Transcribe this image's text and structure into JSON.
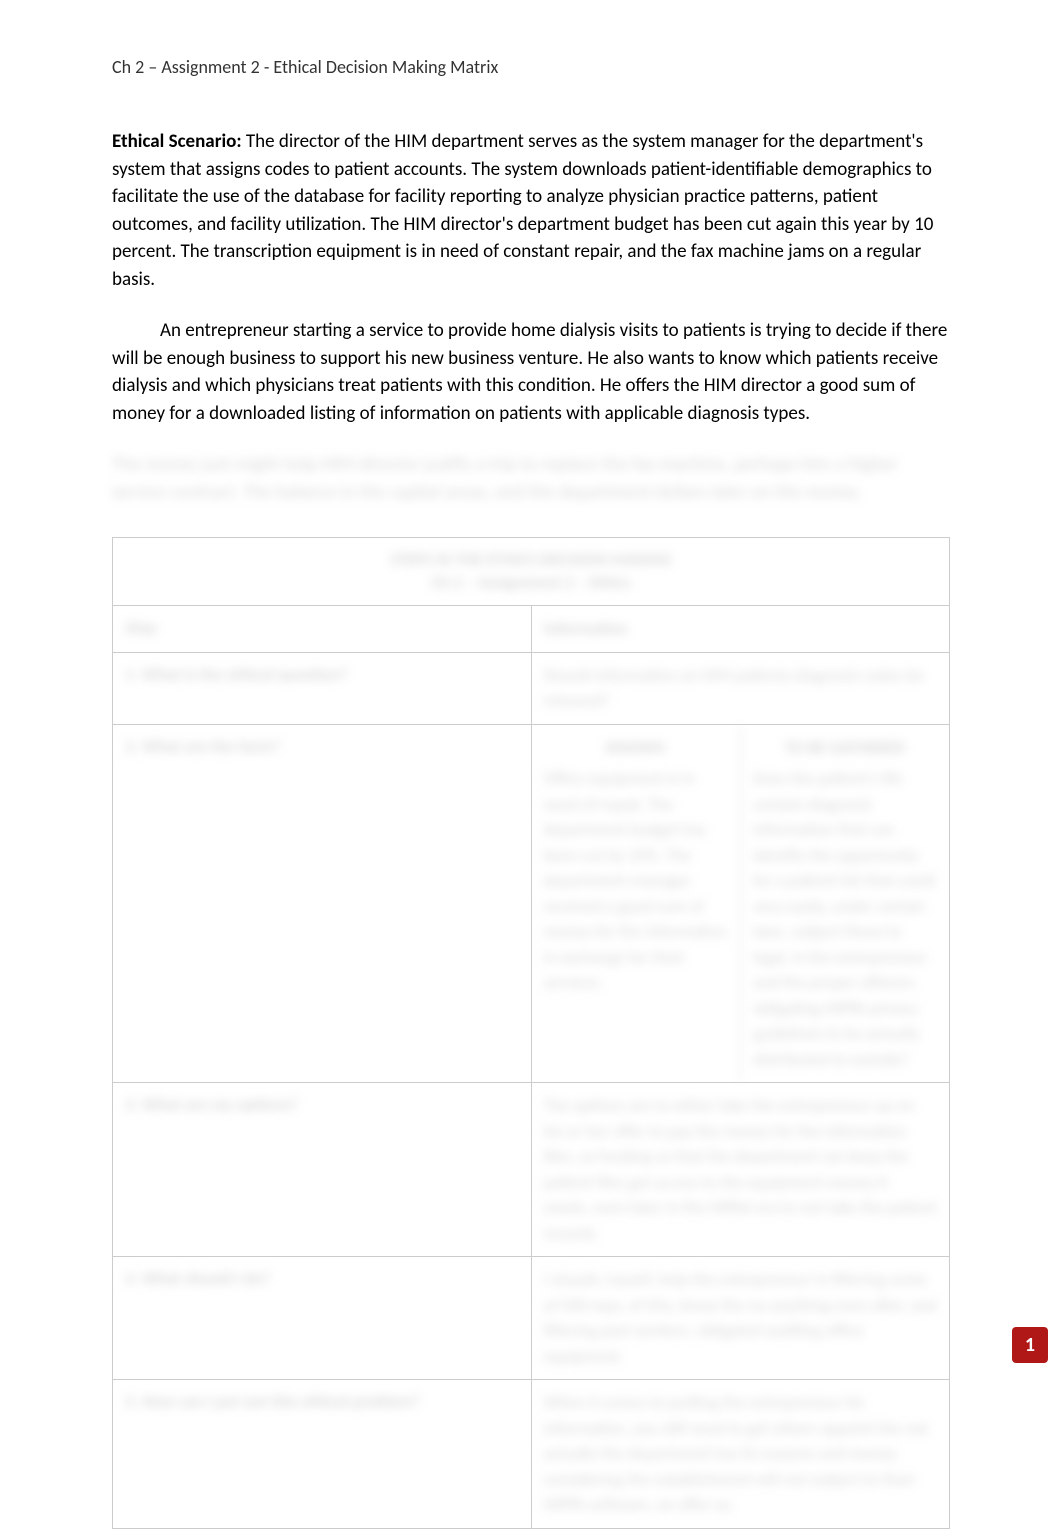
{
  "header": {
    "title": "Ch 2 – Assignment 2 - Ethical Decision Making Matrix"
  },
  "scenario": {
    "label": "Ethical Scenario:",
    "para1": "The director of the HIM department serves as the system manager for the department's system that assigns codes to patient accounts.  The system downloads patient-identifiable demographics to facilitate the use of the database for facility reporting to analyze physician practice patterns, patient outcomes, and facility utilization.  The HIM director's department budget has been cut again this year by 10 percent.  The transcription equipment is in need of constant repair, and the fax machine jams on a regular basis.",
    "para2": "An entrepreneur starting a service to provide home dialysis visits to patients is trying to decide if there will be enough business to support his new business venture. He also wants to know which patients receive dialysis and which physicians treat patients with this condition.  He offers the HIM director a good sum of money for a downloaded listing of information on patients with applicable diagnosis types."
  },
  "blurred_trail": "The money just might help HIM director justify a trip to replace the fax machine, perhaps hire a higher service contract.     The balance in the capital areas, and the department dollars later on the money.",
  "matrix": {
    "title_line1": "STEPS IN THE ETHICS DECISION MAKING",
    "title_line2": "Ch 2 – Assignment 2 – Ethics",
    "header_col1": "Step",
    "header_col2": "Information",
    "rows": [
      {
        "step": "1. What is the ethical question?",
        "content": "Should information on HIM patients diagnosis codes be released?"
      },
      {
        "step": "2. What are the facts?",
        "facts_known_head": "KNOWN",
        "facts_known": "Office equipment is in need of repair. The department budget has been cut by 10%. The department manager received a good sum of money for the information in exchange for their services.",
        "facts_gathered_head": "TO BE GATHERED",
        "facts_gathered": "Does the patient's file contain diagnosis information that can identify the opportunity for a patient list that could very easily, under certain laws, subject these to legal. Is the entrepreneur and the proper offerors obligating HIPPA privacy guidelines to be actually distributed to outside?"
      },
      {
        "step": "3. What are my options?",
        "content": "The options are to either take the entrepreneur up on his or her offer to pay the money for the information files, so funding so that the department can keep the patient files get access to the equipment money it needs, even later in the HIPAA era to not take the patient records."
      },
      {
        "step": "4. What should I do?",
        "content": "I should, myself, help the entrepreneur in filtering some of 500 reps, of this, know the no anything even after, and filtering past workers, obligated auditing office equipment."
      },
      {
        "step": "5. How can I put out this ethical problem?",
        "content": "When it comes to putting the entrepreneur for information, you still need to get others appoint the not actually the department has its reasons and money considering the establishment will not subject to their HIPPA software, an offer so."
      }
    ]
  },
  "badge": {
    "text": "1"
  }
}
